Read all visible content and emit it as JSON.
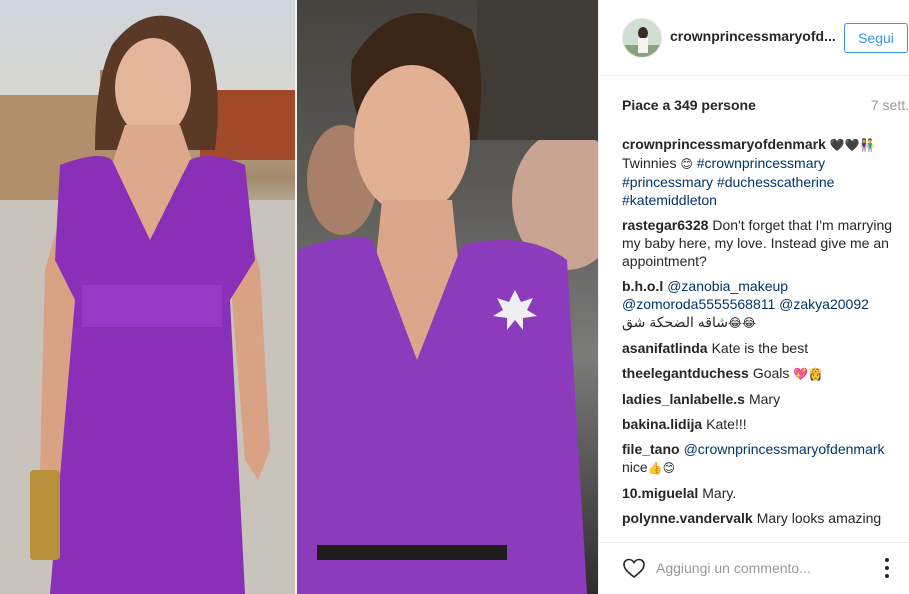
{
  "post": {
    "username": "crownprincessmaryofd...",
    "follow_label": "Segui",
    "likes": "Piace a 349 persone",
    "time": "7 sett."
  },
  "comments": [
    {
      "user": "crownprincessmaryofdenmark",
      "parts": [
        {
          "type": "emoji",
          "text": "🖤🖤👫"
        },
        {
          "type": "br"
        },
        {
          "type": "text",
          "text": "Twinnies "
        },
        {
          "type": "emoji",
          "text": "😊"
        },
        {
          "type": "tag",
          "text": " #crownprincessmary"
        },
        {
          "type": "tag",
          "text": " #princessmary"
        },
        {
          "type": "tag",
          "text": " #duchesscatherine"
        },
        {
          "type": "tag",
          "text": " #katemiddleton"
        }
      ]
    },
    {
      "user": "rastegar6328",
      "parts": [
        {
          "type": "text",
          "text": "Don't forget that I'm marrying my baby here, my love. Instead give me an appointment?"
        }
      ]
    },
    {
      "user": "b.h.o.l",
      "parts": [
        {
          "type": "tag",
          "text": "@zanobia_makeup"
        },
        {
          "type": "tag",
          "text": " @zomoroda5555568811"
        },
        {
          "type": "tag",
          "text": " @zakya20092"
        },
        {
          "type": "text",
          "text": " شاقه الضحكة شق"
        },
        {
          "type": "emoji",
          "text": "😂😂"
        }
      ]
    },
    {
      "user": "asanifatlinda",
      "parts": [
        {
          "type": "text",
          "text": "Kate is the best"
        }
      ]
    },
    {
      "user": "theelegantduchess",
      "parts": [
        {
          "type": "text",
          "text": "Goals "
        },
        {
          "type": "emoji",
          "text": "💖👸"
        }
      ]
    },
    {
      "user": "ladies_lanlabelle.s",
      "parts": [
        {
          "type": "text",
          "text": "Mary"
        }
      ]
    },
    {
      "user": "bakina.lidija",
      "parts": [
        {
          "type": "text",
          "text": "Kate!!!"
        }
      ]
    },
    {
      "user": "file_tano",
      "parts": [
        {
          "type": "tag",
          "text": "@crownprincessmaryofdenmark"
        },
        {
          "type": "text",
          "text": " nice"
        },
        {
          "type": "emoji",
          "text": "👍😊"
        }
      ]
    },
    {
      "user": "10.miguelal",
      "parts": [
        {
          "type": "text",
          "text": "Mary."
        }
      ]
    },
    {
      "user": "polynne.vandervalk",
      "parts": [
        {
          "type": "text",
          "text": "Mary looks amazing and beautiful"
        }
      ]
    }
  ],
  "comment_box": {
    "placeholder": "Aggiungi un commento..."
  },
  "icons": {
    "like": "heart-icon",
    "more": "more-options-icon"
  },
  "colors": {
    "accent": "#3897f0",
    "tag": "#003569",
    "dress": "#8a2fb8"
  }
}
